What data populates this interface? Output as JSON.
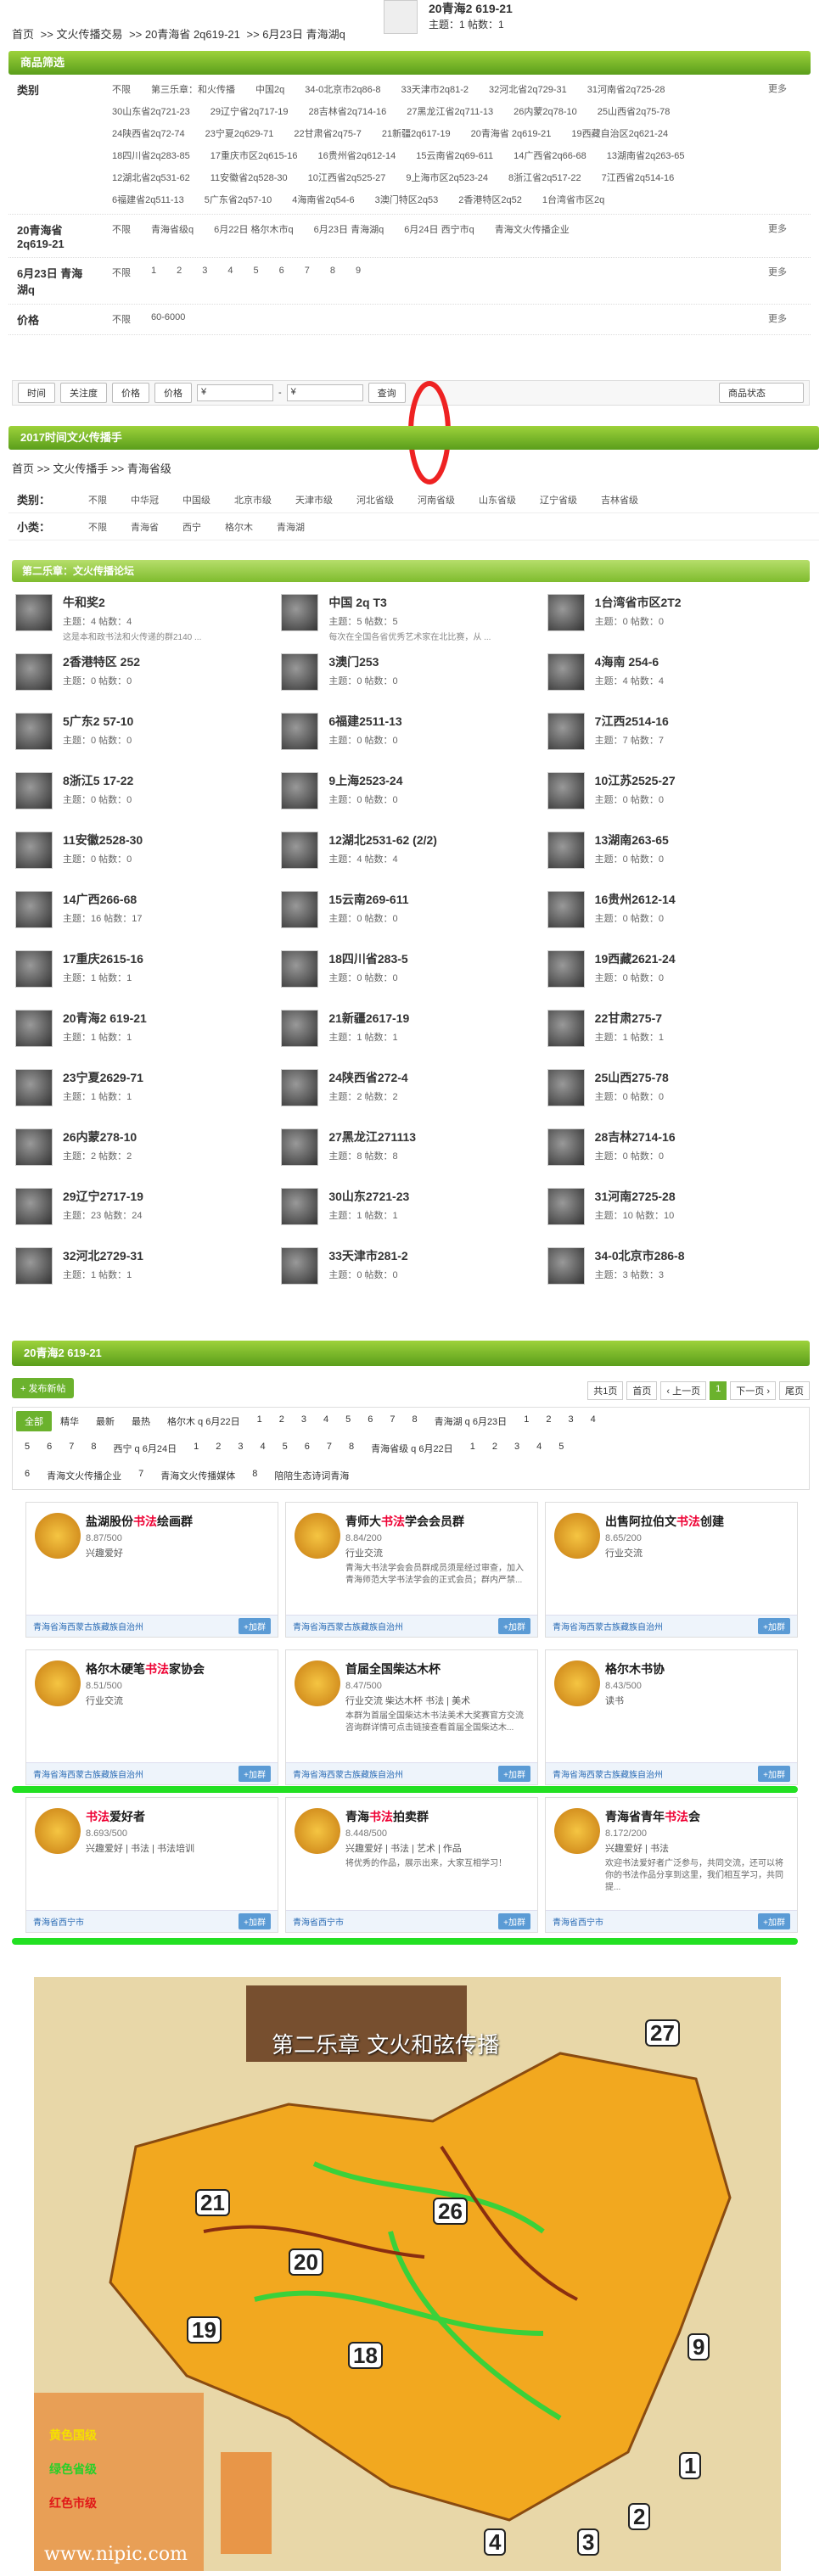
{
  "top": {
    "breadcrumb": [
      "首页",
      "文火传播交易",
      ">> 20青海省 2q619-21",
      ">> 6月23日 青海湖q"
    ],
    "title": "20青海2 619-21",
    "meta": "主题：1 帖数：1"
  },
  "filter": {
    "header": "商品筛选",
    "category_label": "类别",
    "category_options": [
      "不限",
      "第三乐章：和火传播",
      "中国2q",
      "34-0北京市2q86-8",
      "33天津市2q81-2",
      "32河北省2q729-31",
      "31河南省2q725-28",
      "30山东省2q721-23",
      "29辽宁省2q717-19",
      "28吉林省2q714-16",
      "27黑龙江省2q711-13",
      "26内蒙2q78-10",
      "25山西省2q75-78",
      "24陕西省2q72-74",
      "23宁夏2q629-71",
      "22甘肃省2q75-7",
      "21新疆2q617-19",
      "20青海省 2q619-21",
      "19西藏自治区2q621-24",
      "18四川省2q283-85",
      "17重庆市区2q615-16",
      "16贵州省2q612-14",
      "15云南省2q69-611",
      "14广西省2q66-68",
      "13湖南省2q263-65",
      "12湖北省2q531-62",
      "11安徽省2q528-30",
      "10江西省2q525-27",
      "9上海市区2q523-24",
      "8浙江省2q517-22",
      "7江西省2q514-16",
      "6福建省2q511-13",
      "5广东省2q57-10",
      "4海南省2q54-6",
      "3澳门特区2q53",
      "2香港特区2q52",
      "1台湾省市区2q"
    ],
    "province_label": "20青海省 2q619-21",
    "province_options": [
      "不限",
      "青海省级q",
      "6月22日 格尔木市q",
      "6月23日 青海湖q",
      "6月24日 西宁市q",
      "青海文火传播企业"
    ],
    "day_label": "6月23日 青海湖q",
    "day_options": [
      "不限",
      "1",
      "2",
      "3",
      "4",
      "5",
      "6",
      "7",
      "8",
      "9"
    ],
    "price_label": "价格",
    "price_options": [
      "不限",
      "60-6000"
    ],
    "more": "更多",
    "toolbar": [
      "时间",
      "关注度",
      "价格",
      "价格",
      "¥",
      "-",
      "¥",
      "查询",
      "商品状态"
    ]
  },
  "sec2": {
    "header": "2017时间文火传播手",
    "breadcrumb": "首页 >> 文火传播手 >> 青海省级",
    "cat_label": "类别：",
    "cat_options": [
      "不限",
      "中华冠",
      "中国级",
      "北京市级",
      "天津市级",
      "河北省级",
      "河南省级",
      "山东省级",
      "辽宁省级",
      "吉林省级"
    ],
    "sub_label": "小类：",
    "sub_options": [
      "不限",
      "青海省",
      "西宁",
      "格尔木",
      "青海湖"
    ]
  },
  "forum": {
    "header": "第二乐章：文火传播论坛",
    "items": [
      {
        "name": "牛和奖2",
        "meta": "主题：4 帖数：4",
        "desc": "这是本和政书法和火传递的群2140 ..."
      },
      {
        "name": "中国 2q T3",
        "meta": "主题：5 帖数：5",
        "desc": "每次在全国各省优秀艺术家在北比赛，从 ..."
      },
      {
        "name": "1台湾省市区2T2",
        "meta": "主题：0 帖数：0",
        "desc": ""
      },
      {
        "name": "2香港特区 252",
        "meta": "主题：0 帖数：0",
        "desc": ""
      },
      {
        "name": "3澳门253",
        "meta": "主题：0 帖数：0",
        "desc": ""
      },
      {
        "name": "4海南 254-6",
        "meta": "主题：4 帖数：4",
        "desc": ""
      },
      {
        "name": "5广东2 57-10",
        "meta": "主题：0 帖数：0",
        "desc": ""
      },
      {
        "name": "6福建2511-13",
        "meta": "主题：0 帖数：0",
        "desc": ""
      },
      {
        "name": "7江西2514-16",
        "meta": "主题：7 帖数：7",
        "desc": ""
      },
      {
        "name": "8浙江5 17-22",
        "meta": "主题：0 帖数：0",
        "desc": ""
      },
      {
        "name": "9上海2523-24",
        "meta": "主题：0 帖数：0",
        "desc": ""
      },
      {
        "name": "10江苏2525-27",
        "meta": "主题：0 帖数：0",
        "desc": ""
      },
      {
        "name": "11安徽2528-30",
        "meta": "主题：0 帖数：0",
        "desc": ""
      },
      {
        "name": "12湖北2531-62 (2/2)",
        "meta": "主题：4 帖数：4",
        "desc": ""
      },
      {
        "name": "13湖南263-65",
        "meta": "主题：0 帖数：0",
        "desc": ""
      },
      {
        "name": "14广西266-68",
        "meta": "主题：16 帖数：17",
        "desc": ""
      },
      {
        "name": "15云南269-611",
        "meta": "主题：0 帖数：0",
        "desc": ""
      },
      {
        "name": "16贵州2612-14",
        "meta": "主题：0 帖数：0",
        "desc": ""
      },
      {
        "name": "17重庆2615-16",
        "meta": "主题：1 帖数：1",
        "desc": ""
      },
      {
        "name": "18四川省283-5",
        "meta": "主题：0 帖数：0",
        "desc": ""
      },
      {
        "name": "19西藏2621-24",
        "meta": "主题：0 帖数：0",
        "desc": ""
      },
      {
        "name": "20青海2 619-21",
        "meta": "主题：1 帖数：1",
        "desc": ""
      },
      {
        "name": "21新疆2617-19",
        "meta": "主题：1 帖数：1",
        "desc": ""
      },
      {
        "name": "22甘肃275-7",
        "meta": "主题：1 帖数：1",
        "desc": ""
      },
      {
        "name": "23宁夏2629-71",
        "meta": "主题：1 帖数：1",
        "desc": ""
      },
      {
        "name": "24陕西省272-4",
        "meta": "主题：2 帖数：2",
        "desc": ""
      },
      {
        "name": "25山西275-78",
        "meta": "主题：0 帖数：0",
        "desc": ""
      },
      {
        "name": "26内蒙278-10",
        "meta": "主题：2 帖数：2",
        "desc": ""
      },
      {
        "name": "27黑龙江271113",
        "meta": "主题：8 帖数：8",
        "desc": ""
      },
      {
        "name": "28吉林2714-16",
        "meta": "主题：0 帖数：0",
        "desc": ""
      },
      {
        "name": "29辽宁2717-19",
        "meta": "主题：23 帖数：24",
        "desc": ""
      },
      {
        "name": "30山东2721-23",
        "meta": "主题：1 帖数：1",
        "desc": ""
      },
      {
        "name": "31河南2725-28",
        "meta": "主题：10 帖数：10",
        "desc": ""
      },
      {
        "name": "32河北2729-31",
        "meta": "主题：1 帖数：1",
        "desc": ""
      },
      {
        "name": "33天津市281-2",
        "meta": "主题：0 帖数：0",
        "desc": ""
      },
      {
        "name": "34-0北京市286-8",
        "meta": "主题：3 帖数：3",
        "desc": ""
      }
    ]
  },
  "sec3": {
    "header": "20青海2 619-21",
    "post_button": "+ 发布新帖",
    "pager": [
      "共1页",
      "首页",
      "‹ 上一页",
      "1",
      "下一页 ›",
      "尾页"
    ],
    "tabs_row1": [
      "全部",
      "精华",
      "最新",
      "最热",
      "格尔木 q 6月22日",
      "1",
      "2",
      "3",
      "4",
      "5",
      "6",
      "7",
      "8",
      "青海湖 q 6月23日",
      "1",
      "2",
      "3",
      "4"
    ],
    "tabs_row2": [
      "5",
      "6",
      "7",
      "8",
      "西宁 q 6月24日",
      "1",
      "2",
      "3",
      "4",
      "5",
      "6",
      "7",
      "8",
      "青海省级 q 6月22日",
      "1",
      "2",
      "3",
      "4",
      "5"
    ],
    "tabs_row3": [
      "6",
      "青海文火传播企业",
      "7",
      "青海文火传播媒体",
      "8",
      "陪陪生态诗词青海"
    ]
  },
  "groups": [
    {
      "name_pre": "盐湖股份",
      "name_hl": "书法",
      "name_post": "绘画群",
      "meta": "8.87/500",
      "tags": "兴趣爱好",
      "desc": "",
      "loc": "青海省海西蒙古族藏族自治州",
      "join": "+加群"
    },
    {
      "name_pre": "青师大",
      "name_hl": "书法",
      "name_post": "学会会员群",
      "meta": "8.84/200",
      "tags": "行业交流",
      "desc": "青海大书法学会会员群成员须是经过审查，加入青海师范大学书法学会的正式会员；群内严禁...",
      "loc": "青海省海西蒙古族藏族自治州",
      "join": "+加群"
    },
    {
      "name_pre": "出售阿拉伯文",
      "name_hl": "书法",
      "name_post": "创建",
      "meta": "8.65/200",
      "tags": "行业交流",
      "desc": "",
      "loc": "青海省海西蒙古族藏族自治州",
      "join": "+加群"
    },
    {
      "name_pre": "格尔木硬笔",
      "name_hl": "书法",
      "name_post": "家协会",
      "meta": "8.51/500",
      "tags": "行业交流",
      "desc": "",
      "loc": "青海省海西蒙古族藏族自治州",
      "join": "+加群"
    },
    {
      "name_pre": "首届全国柴达木杯",
      "name_hl": "",
      "name_post": "",
      "meta": "8.47/500",
      "tags": "行业交流 柴达木杯 书法 | 美术",
      "desc": "本群为首届全国柴达木书法美术大奖赛官方交流咨询群详情可点击链接查看首届全国柴达木...",
      "loc": "青海省海西蒙古族藏族自治州",
      "join": "+加群"
    },
    {
      "name_pre": "格尔木书协",
      "name_hl": "",
      "name_post": "",
      "meta": "8.43/500",
      "tags": "读书",
      "desc": "",
      "loc": "青海省海西蒙古族藏族自治州",
      "join": "+加群"
    },
    {
      "name_pre": "",
      "name_hl": "书法",
      "name_post": "爱好者",
      "meta": "8.693/500",
      "tags": "兴趣爱好 | 书法 | 书法培训",
      "desc": "",
      "loc": "青海省西宁市",
      "join": "+加群"
    },
    {
      "name_pre": "青海",
      "name_hl": "书法",
      "name_post": "拍卖群",
      "meta": "8.448/500",
      "tags": "兴趣爱好 | 书法 | 艺术 | 作品",
      "desc": "将优秀的作品，展示出来，大家互相学习！",
      "loc": "青海省西宁市",
      "join": "+加群"
    },
    {
      "name_pre": "青海省青年",
      "name_hl": "书法",
      "name_post": "会",
      "meta": "8.172/200",
      "tags": "兴趣爱好 | 书法",
      "desc": "欢迎书法爱好者广泛参与，共同交流，还可以将你的书法作品分享到这里，我们相互学习，共同提...",
      "loc": "青海省西宁市",
      "join": "+加群"
    }
  ],
  "map": {
    "title": "第二乐章   文火和弦传播",
    "legend": [
      "黄色国级",
      "绿色省级",
      "红色市级"
    ],
    "watermark": "www.nipic.com",
    "numbers": [
      "27",
      "20",
      "21",
      "26",
      "19",
      "18",
      "9",
      "4",
      "3",
      "2",
      "1"
    ]
  }
}
